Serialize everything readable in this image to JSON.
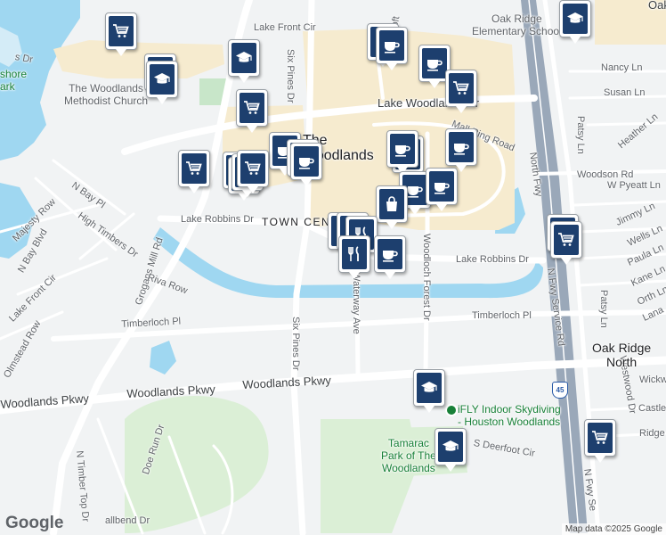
{
  "map": {
    "colors": {
      "background": "#f1f3f4",
      "water": "#9fd7f1",
      "commercial": "#f6ebcf",
      "park": "#c8e6c9",
      "road": "#ffffff",
      "highway": "#9aa8b9",
      "marker": "#1d3f6e"
    },
    "labels": {
      "road_lake_front_cir_n": "Lake Front Cir",
      "road_six_pines_n": "Six Pines Dr",
      "road_pinecroft": "Pinecroft",
      "road_lake_woodlands_dr": "Lake Woodlands Dr",
      "road_mall_ring": "Mall Ring Road",
      "road_north_fwy": "North Fwy",
      "road_nancy": "Nancy Ln",
      "road_susan": "Susan Ln",
      "road_patsy_n": "Patsy Ln",
      "road_heather": "Heather Ln",
      "road_woodson": "Woodson Rd",
      "road_w_pyeatt": "W Pyeatt Ln",
      "road_jimmy": "Jimmy Ln",
      "road_wells": "Wells Ln",
      "road_paula": "Paula Ln",
      "road_kane": "Kane Ln",
      "road_orth": "Orth Ln",
      "road_lana": "Lana",
      "road_patsy_s": "Patsy Ln",
      "road_lake_robbins_w": "Lake Robbins Dr",
      "road_lake_robbins_e": "Lake Robbins Dr",
      "road_waterway": "Waterway Ave",
      "road_woodloch_forest": "Woodloch Forest Dr",
      "road_timberloch_w": "Timberloch Pl",
      "road_timberloch_e": "Timberloch Pl",
      "road_six_pines_s": "Six Pines Dr",
      "road_grogans_mill": "Grogans Mill Rd",
      "road_riva_row": "Riva Row",
      "road_n_bay_pl": "N Bay Pl",
      "road_majesty": "Majesty Row",
      "road_high_timbers": "High Timbers Dr",
      "road_n_bay_blvd": "N Bay Blvd",
      "road_lake_front_cir_s": "Lake Front Cir",
      "road_olmstead": "Olmstead Row",
      "road_woodlands_pkwy_w": "Woodlands Pkwy",
      "road_woodlands_pkwy_e": "Woodlands Pkwy",
      "road_doe_run": "Doe Run Dr",
      "road_n_timber_top": "N Timber Top Dr",
      "road_fallbend": "allbend Dr",
      "road_n_fwy_service": "N Fwy Service Rd",
      "road_n_fwy_se": "N Fwy Se",
      "road_s_deerfoot": "S Deerfoot Cir",
      "road_westwood": "Westwood Dr",
      "road_wickw": "Wickw",
      "road_castle": "Castle",
      "road_ridge": "Ridge",
      "road_s_dr": "s Dr",
      "poi_oak_ridge_school": "Oak Ridge\nElementary School",
      "poi_methodist": "The Woodlands\nMethodist Church",
      "poi_shore_park": "shore\nark",
      "poi_the_woodlands": "The\nWoodlands",
      "poi_town_center": "TOWN CENTER",
      "poi_ifly": "iFLY Indoor Skydiving\n- Houston Woodlands",
      "poi_tamarac": "Tamarac\nPark of The\nWoodlands",
      "city_oak_ridge_north": "Oak Ridge\nNorth",
      "poi_oak_top": "Oak",
      "highway_shield": "45"
    },
    "markers": [
      {
        "icon": "cart-icon"
      },
      {
        "icon": "school-icon"
      },
      {
        "icon": "school-icon"
      },
      {
        "icon": "school-icon"
      },
      {
        "icon": "coffee-icon"
      },
      {
        "icon": "coffee-icon"
      },
      {
        "icon": "coffee-icon"
      },
      {
        "icon": "cart-icon"
      },
      {
        "icon": "school-icon"
      },
      {
        "icon": "cart-icon"
      },
      {
        "icon": "coffee-icon"
      },
      {
        "icon": "coffee-icon"
      },
      {
        "icon": "coffee-icon"
      },
      {
        "icon": "cart-icon"
      },
      {
        "icon": "cart-icon"
      },
      {
        "icon": "cart-icon"
      },
      {
        "icon": "cart-icon"
      },
      {
        "icon": "cart-icon"
      },
      {
        "icon": "coffee-icon"
      },
      {
        "icon": "school-icon"
      },
      {
        "icon": "coffee-icon"
      },
      {
        "icon": "coffee-icon"
      },
      {
        "icon": "coffee-icon"
      },
      {
        "icon": "bag-icon"
      },
      {
        "icon": "restaurant-icon"
      },
      {
        "icon": "restaurant-icon"
      },
      {
        "icon": "restaurant-icon"
      },
      {
        "icon": "restaurant-icon"
      },
      {
        "icon": "coffee-icon"
      },
      {
        "icon": "cart-icon"
      },
      {
        "icon": "cart-icon"
      },
      {
        "icon": "school-icon"
      },
      {
        "icon": "school-icon"
      },
      {
        "icon": "cart-icon"
      }
    ],
    "logo": "Google",
    "attribution": "Map data ©2025 Google"
  }
}
